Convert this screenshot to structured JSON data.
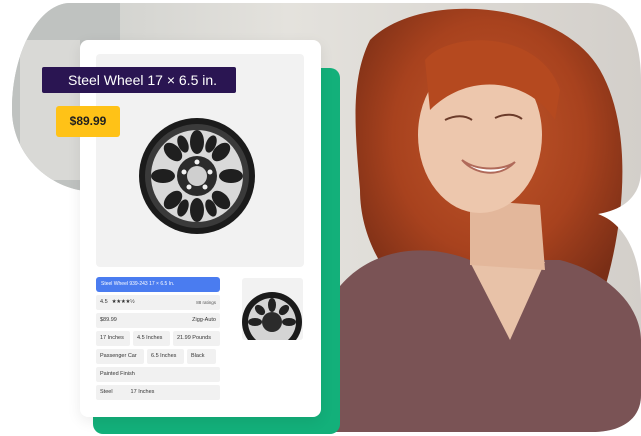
{
  "product": {
    "title": "Steel Wheel 17 × 6.5 in.",
    "price": "$89.99",
    "listing_title": "Steel Wheel 939-243 17 × 6.5 In.",
    "rating": "4.5",
    "stars": "★★★★½",
    "ratings_count": "88 ratings",
    "list_price": "$89.99",
    "brand": "Zigg-Auto",
    "size_1": "17 Inches",
    "width": "4.5 Inches",
    "weight": "21.99 Pounds",
    "vehicle": "Passenger Car",
    "offset": "6.5 Inches",
    "color": "Black",
    "finish": "Painted Finish",
    "material": "Steel",
    "size_2": "17 Inches"
  },
  "colors": {
    "accent_green": "#13b07a",
    "title_badge": "#2a1552",
    "price_badge": "#ffc217",
    "title_bar": "#4a7cf0"
  }
}
